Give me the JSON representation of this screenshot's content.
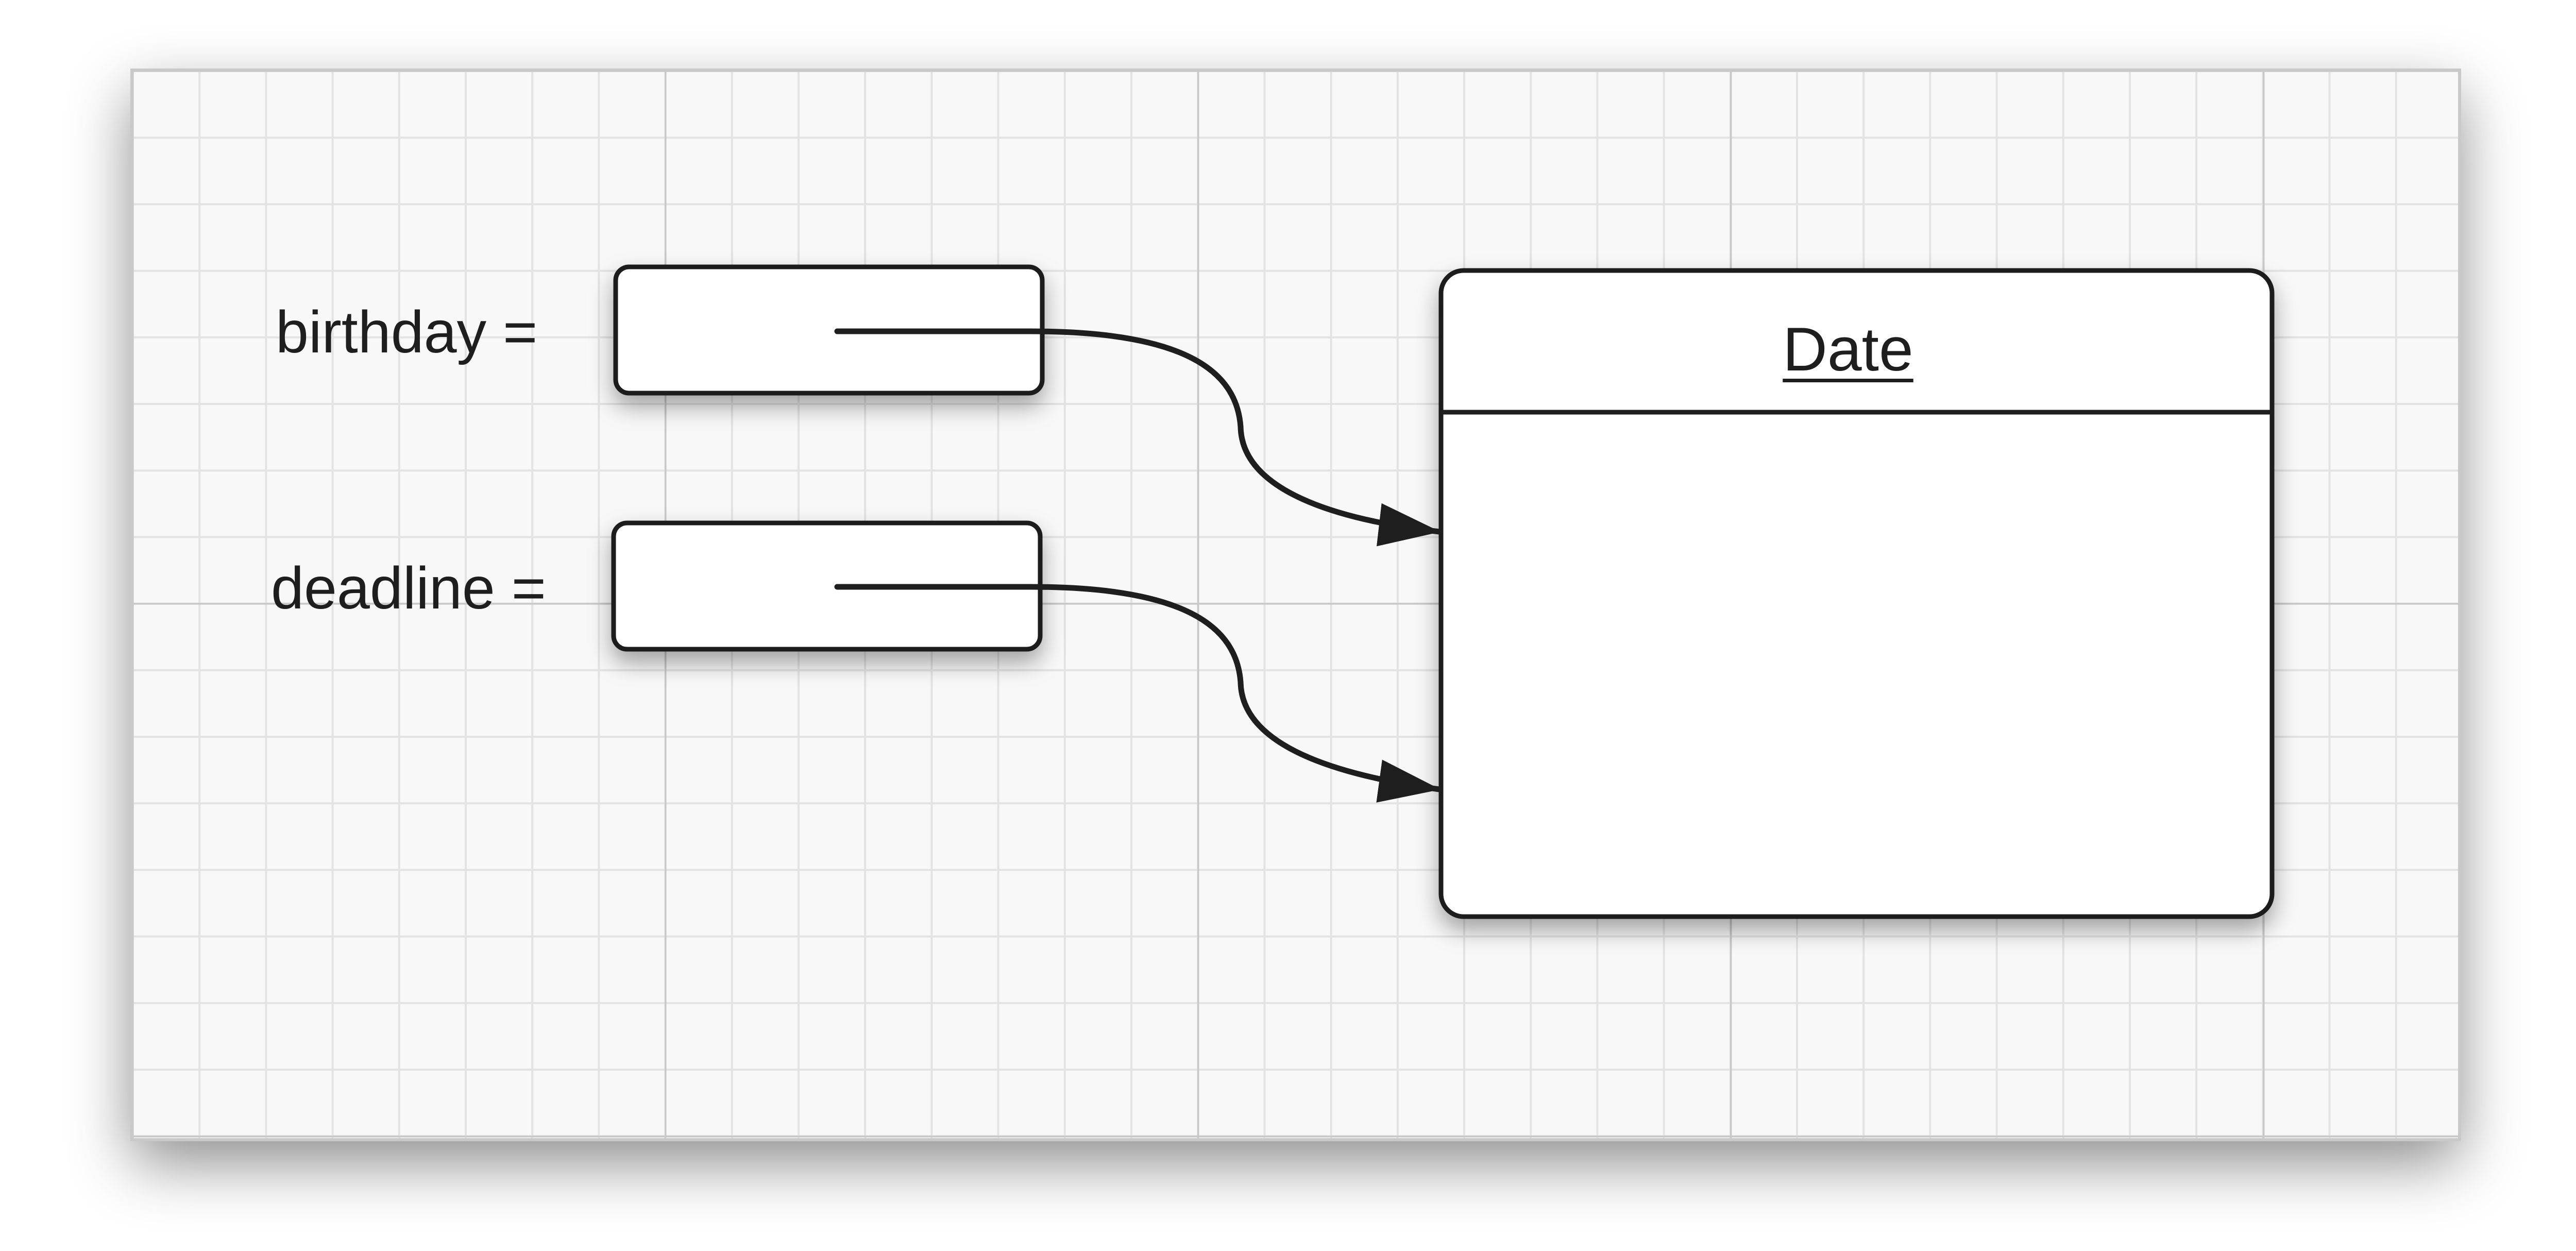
{
  "diagram": {
    "variables": [
      {
        "id": "birthday",
        "label": "birthday ="
      },
      {
        "id": "deadline",
        "label": "deadline ="
      }
    ],
    "object": {
      "class_name": "Date"
    },
    "references": [
      {
        "from": "birthday",
        "to": "Date"
      },
      {
        "from": "deadline",
        "to": "Date"
      }
    ]
  },
  "colors": {
    "background": "#ffffff",
    "grid_paper": "#f8f8f8",
    "grid_minor": "#e3e3e3",
    "grid_major": "#c9c9c9",
    "stroke": "#1e1e1e",
    "box_fill": "#ffffff"
  }
}
